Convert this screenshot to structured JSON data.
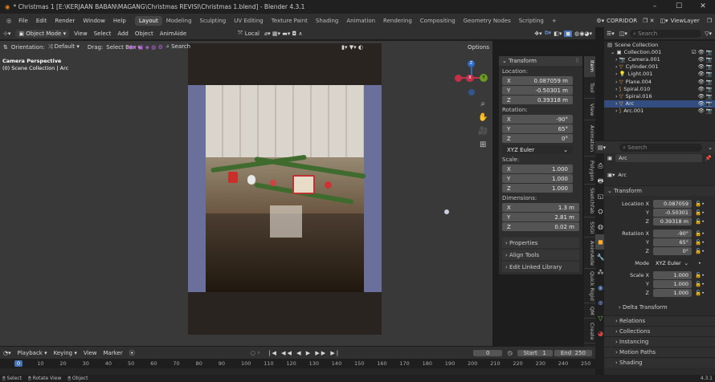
{
  "title": "* Christmas 1 [E:\\KERJAAN BABAN\\MAGANG\\Christmas REVISI\\Christmas 1.blend] - Blender 4.3.1",
  "window": {
    "min": "–",
    "max": "☐",
    "close": "✕"
  },
  "menu": [
    "File",
    "Edit",
    "Render",
    "Window",
    "Help"
  ],
  "workspaces": [
    "Layout",
    "Modeling",
    "Sculpting",
    "UV Editing",
    "Texture Paint",
    "Shading",
    "Animation",
    "Rendering",
    "Compositing",
    "Geometry Nodes",
    "Scripting",
    "+"
  ],
  "scene": {
    "name": "CORRIDOR",
    "view_layer": "ViewLayer"
  },
  "viewport_header": {
    "mode": "Object Mode",
    "view": "View",
    "select": "Select",
    "add": "Add",
    "object": "Object",
    "addon": "AnimAide",
    "transform": "Local",
    "search": "Search"
  },
  "viewport_header2": {
    "orientation_label": "Orientation:",
    "orientation": "Default",
    "drag_label": "Drag:",
    "drag": "Select Box",
    "options": "Options"
  },
  "overlay_text": {
    "line1": "Camera Perspective",
    "line2": "(0) Scene Collection | Arc"
  },
  "gizmo": {
    "x": "X",
    "y": "Y",
    "z": "Z"
  },
  "npanel": {
    "header": "Transform",
    "location_label": "Location:",
    "location": [
      {
        "axis": "X",
        "value": "0.087059 m"
      },
      {
        "axis": "Y",
        "value": "-0.50301 m"
      },
      {
        "axis": "Z",
        "value": "0.39318 m"
      }
    ],
    "rotation_label": "Rotation:",
    "rotation": [
      {
        "axis": "X",
        "value": "-90°"
      },
      {
        "axis": "Y",
        "value": "65°"
      },
      {
        "axis": "Z",
        "value": "0°"
      }
    ],
    "rotation_mode": "XYZ Euler",
    "scale_label": "Scale:",
    "scale": [
      {
        "axis": "X",
        "value": "1.000"
      },
      {
        "axis": "Y",
        "value": "1.000"
      },
      {
        "axis": "Z",
        "value": "1.000"
      }
    ],
    "dimensions_label": "Dimensions:",
    "dimensions": [
      {
        "axis": "X",
        "value": "1.3 m"
      },
      {
        "axis": "Y",
        "value": "2.81 m"
      },
      {
        "axis": "Z",
        "value": "0.02 m"
      }
    ],
    "sections": [
      "Properties",
      "Align Tools",
      "Edit Linked Library"
    ]
  },
  "vtabs": [
    "Item",
    "Tool",
    "View",
    "Animation",
    "Polygon",
    "Sketchfab",
    "SSGI",
    "AnimAide",
    "Quick Rigid",
    "QM",
    "Create"
  ],
  "outliner": {
    "search": "Search",
    "root": "Scene Collection",
    "items": [
      "Collection.001",
      "Camera.001",
      "Cylinder.001",
      "Light.001",
      "Plane.004",
      "Spiral.010",
      "Spiral.016",
      "Arc",
      "Arc.001"
    ]
  },
  "properties": {
    "search": "Search",
    "object": "Arc",
    "data": "Arc",
    "transform_header": "Transform",
    "location_label": "Location X",
    "location": [
      "0.087059",
      "-0.50301",
      "0.39318 m"
    ],
    "rotation_label": "Rotation X",
    "rotation": [
      "-90°",
      "65°",
      "0°"
    ],
    "mode_label": "Mode",
    "mode": "XYZ Euler",
    "scale_label": "Scale X",
    "scale": [
      "1.000",
      "1.000",
      "1.000"
    ],
    "axis_y": "Y",
    "axis_z": "Z",
    "delta": "Delta Transform",
    "sections": [
      "Relations",
      "Collections",
      "Instancing",
      "Motion Paths",
      "Shading"
    ]
  },
  "timeline": {
    "playback": "Playback",
    "keying": "Keying",
    "view": "View",
    "marker": "Marker",
    "current": "0",
    "start_label": "Start",
    "start": "1",
    "end_label": "End",
    "end": "250",
    "ticks": [
      "0",
      "10",
      "20",
      "30",
      "40",
      "50",
      "60",
      "70",
      "80",
      "90",
      "100",
      "110",
      "120",
      "130",
      "140",
      "150",
      "160",
      "170",
      "180",
      "190",
      "200",
      "210",
      "220",
      "230",
      "240",
      "250"
    ]
  },
  "status": {
    "select": "Select",
    "rotate": "Rotate View",
    "object": "Object",
    "version": "4.3.1"
  },
  "colors": {
    "accent": "#4772b3",
    "camera_border": "#6a6f9c",
    "gizmo_x": "#c4304a",
    "gizmo_y": "#6a9a22",
    "gizmo_z": "#2f69c4"
  }
}
